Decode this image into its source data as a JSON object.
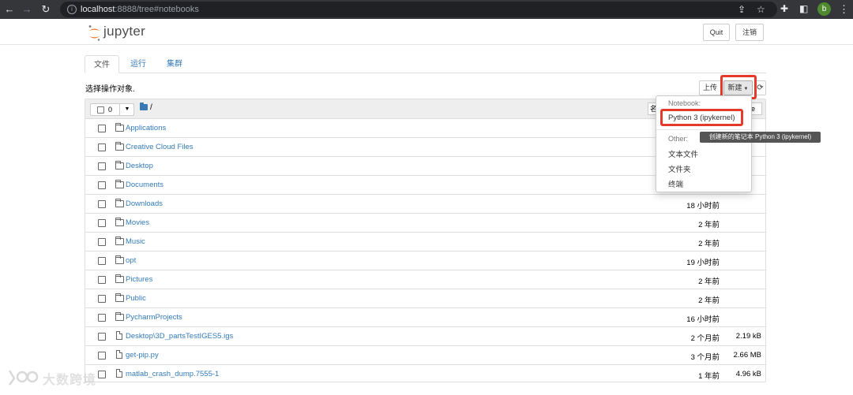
{
  "browser": {
    "url_host": "localhost",
    "url_rest": ":8888/tree#notebooks",
    "profile_initial": "b"
  },
  "header": {
    "logo_text": "jupyter",
    "quit_label": "Quit",
    "logout_label": "注销"
  },
  "tabs": [
    {
      "label": "文件",
      "active": true
    },
    {
      "label": "运行",
      "active": false
    },
    {
      "label": "集群",
      "active": false
    }
  ],
  "toolbar": {
    "select_hint": "选择操作对象.",
    "upload_label": "上传",
    "new_label": "新建"
  },
  "list_header": {
    "selected_count": "0",
    "root_path": "/",
    "name_sort_label": "名",
    "size_sort_label": "e"
  },
  "files": [
    {
      "name": "Applications",
      "type": "folder",
      "modified": "",
      "size": ""
    },
    {
      "name": "Creative Cloud Files",
      "type": "folder",
      "modified": "",
      "size": ""
    },
    {
      "name": "Desktop",
      "type": "folder",
      "modified": "",
      "size": ""
    },
    {
      "name": "Documents",
      "type": "folder",
      "modified": "",
      "size": ""
    },
    {
      "name": "Downloads",
      "type": "folder",
      "modified": "18 小时前",
      "size": ""
    },
    {
      "name": "Movies",
      "type": "folder",
      "modified": "2 年前",
      "size": ""
    },
    {
      "name": "Music",
      "type": "folder",
      "modified": "2 年前",
      "size": ""
    },
    {
      "name": "opt",
      "type": "folder",
      "modified": "19 小时前",
      "size": ""
    },
    {
      "name": "Pictures",
      "type": "folder",
      "modified": "2 年前",
      "size": ""
    },
    {
      "name": "Public",
      "type": "folder",
      "modified": "2 年前",
      "size": ""
    },
    {
      "name": "PycharmProjects",
      "type": "folder",
      "modified": "16 小时前",
      "size": ""
    },
    {
      "name": "Desktop\\3D_partsTestIGES5.igs",
      "type": "file",
      "modified": "2 个月前",
      "size": "2.19 kB"
    },
    {
      "name": "get-pip.py",
      "type": "file",
      "modified": "3 个月前",
      "size": "2.66 MB"
    },
    {
      "name": "matlab_crash_dump.7555-1",
      "type": "file",
      "modified": "1 年前",
      "size": "4.96 kB"
    }
  ],
  "new_menu": {
    "notebook_header": "Notebook:",
    "python_kernel": "Python 3 (ipykernel)",
    "other_header": "Other:",
    "text_file": "文本文件",
    "folder": "文件夹",
    "terminal": "终端",
    "tooltip": "创建新的笔记本 Python 3 (ipykernel)"
  },
  "watermark": "大数跨境",
  "colors": {
    "link": "#337ab7",
    "highlight": "#e53a29",
    "jupyter_orange": "#f37726"
  }
}
